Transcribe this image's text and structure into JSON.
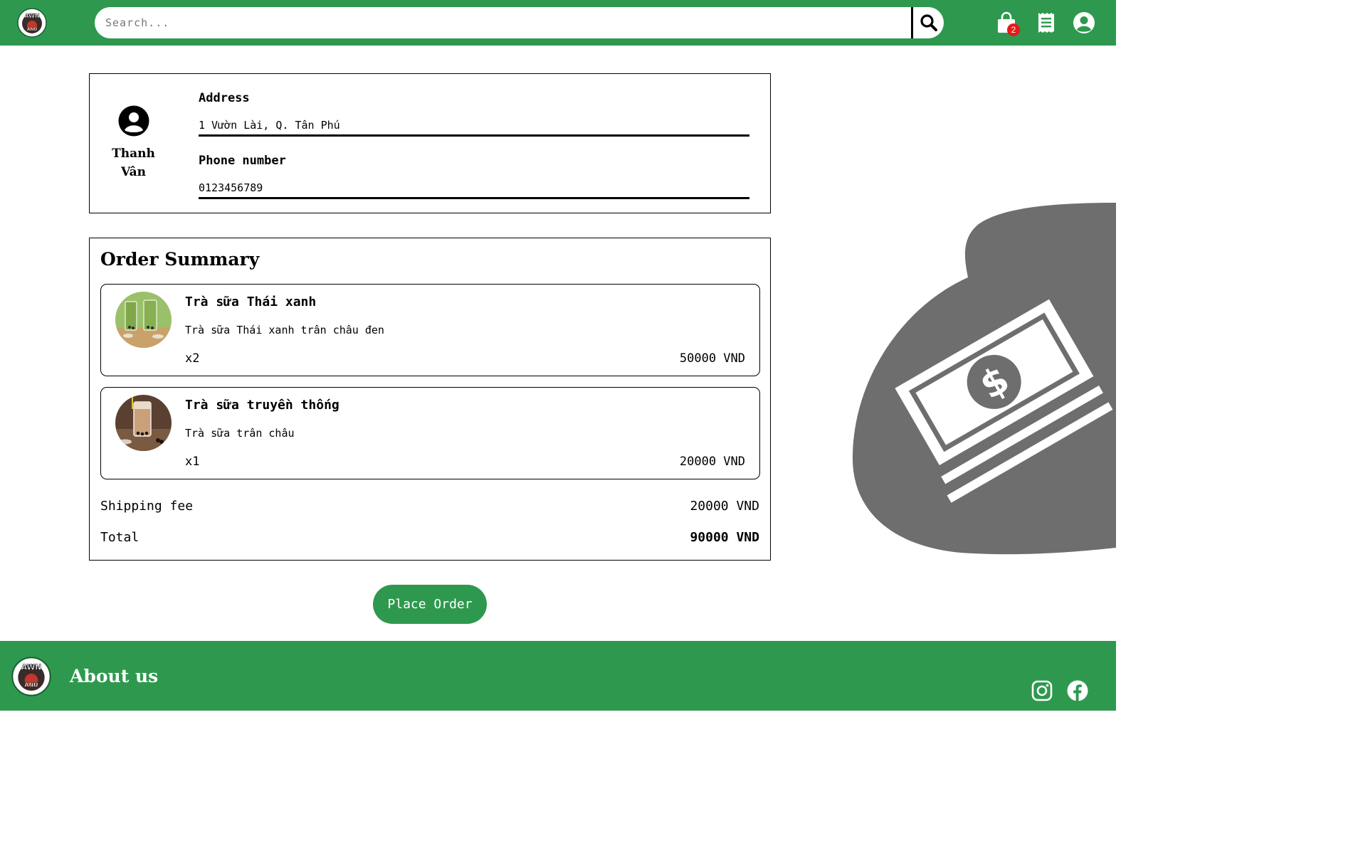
{
  "brand": {
    "logo_text_top": "AWN",
    "logo_text_bottom": "ANU"
  },
  "header": {
    "search_placeholder": "Search...",
    "cart_count": "2",
    "icons": [
      "logo-icon",
      "search-icon",
      "cart-icon",
      "receipt-icon",
      "account-icon"
    ]
  },
  "user": {
    "name": "Thanh Vân",
    "address_label": "Address",
    "address_value": "1 Vườn Lài, Q. Tân Phú",
    "phone_label": "Phone number",
    "phone_value": "0123456789"
  },
  "summary": {
    "title": "Order Summary",
    "items": [
      {
        "name": "Trà sữa Thái xanh",
        "desc": "Trà sữa Thái xanh trân châu đen",
        "qty": "x2",
        "price": "50000 VND"
      },
      {
        "name": "Trà sữa truyền thống",
        "desc": "Trà sữa trân châu",
        "qty": "x1",
        "price": "20000 VND"
      }
    ],
    "shipping_label": "Shipping fee",
    "shipping_value": "20000 VND",
    "total_label": "Total",
    "total_value": "90000 VND"
  },
  "actions": {
    "place_order": "Place Order"
  },
  "footer": {
    "about": "About us",
    "icons": [
      "instagram-icon",
      "facebook-icon"
    ]
  },
  "colors": {
    "brand_green": "#2e994e",
    "badge_red": "#e21b1b",
    "deco_gray": "#6e6e6e"
  }
}
